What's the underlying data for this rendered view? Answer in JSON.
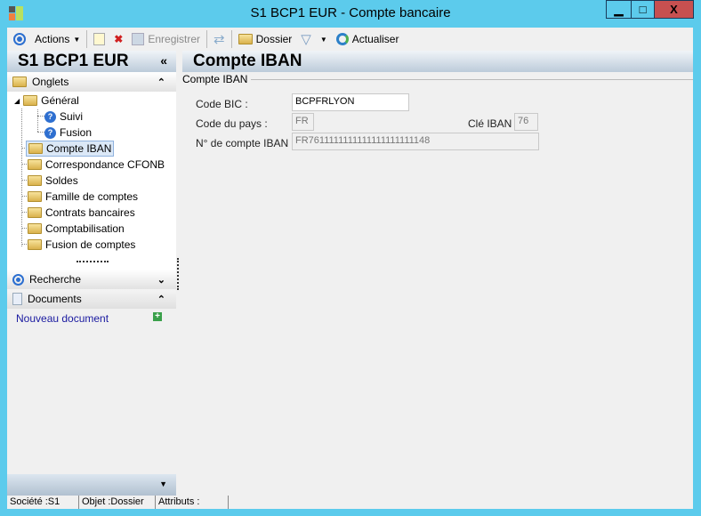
{
  "window": {
    "title": "S1 BCP1 EUR -  Compte bancaire",
    "minimize": "▁",
    "maximize": "□",
    "close": "X"
  },
  "toolbar": {
    "actions": "Actions",
    "save": "Enregistrer",
    "folder": "Dossier",
    "refresh": "Actualiser"
  },
  "left": {
    "title": "S1 BCP1 EUR",
    "collapse": "«",
    "onglets": "Onglets",
    "tree": [
      "Général",
      "Suivi",
      "Fusion",
      "Compte IBAN",
      "Correspondance CFONB",
      "Soldes",
      "Famille de comptes",
      "Contrats bancaires",
      "Comptabilisation",
      "Fusion de comptes"
    ],
    "recherche": "Recherche",
    "documents": "Documents",
    "new_doc": "Nouveau document"
  },
  "main": {
    "title": "Compte IBAN",
    "group": "Compte IBAN",
    "bic_label": "Code BIC :",
    "bic": "BCPFRLYON",
    "country_label": "Code du pays :",
    "country": "FR",
    "key_label": "Clé IBAN :",
    "key": "76",
    "iban_label": "N° de compte IBAN :",
    "iban": "FR7611111111111111111111148"
  },
  "status": {
    "societe": "Société :S1",
    "objet": "Objet :Dossier",
    "attributs": "Attributs :"
  }
}
